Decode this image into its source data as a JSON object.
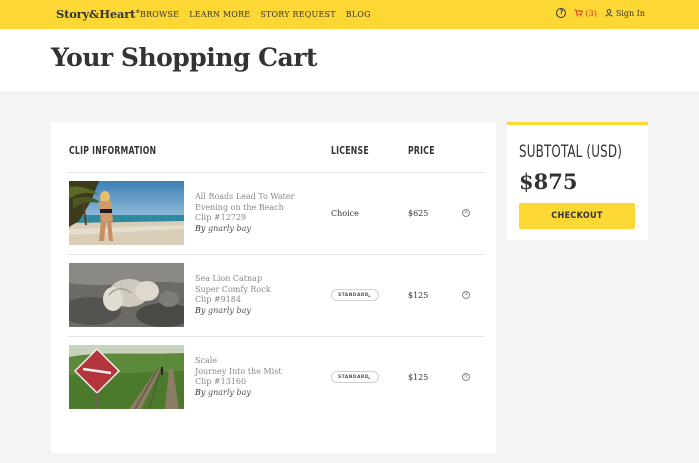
{
  "nav": {
    "logo": "Story&Heart",
    "logo_tm": "®",
    "links": [
      "BROWSE",
      "LEARN MORE",
      "STORY REQUEST",
      "BLOG"
    ],
    "help_icon": "?",
    "cart_count": "(3)",
    "signin": "Sign In"
  },
  "header": {
    "title": "Your Shopping Cart"
  },
  "table": {
    "col_clip": "CLIP INFORMATION",
    "col_license": "LICENSE",
    "col_price": "PRICE"
  },
  "items": [
    {
      "title": "All Roads Lead To Water",
      "subtitle": "Evening on the Beach",
      "clip": "Clip #12729",
      "by": "By",
      "author": "gnarly bay",
      "license": "Choice",
      "price": "$625"
    },
    {
      "title": "Sea Lion Catnap",
      "subtitle": "Super Comfy Rock",
      "clip": "Clip #9184",
      "by": "By",
      "author": "gnarly bay",
      "license": "STANDARD",
      "price": "$125"
    },
    {
      "title": "Scale",
      "subtitle": "Journey Into the Mist",
      "clip": "Clip #13160",
      "by": "By",
      "author": "gnarly bay",
      "license": "STANDARD",
      "price": "$125"
    }
  ],
  "summary": {
    "label": "SUBTOTAL (USD)",
    "amount": "$875",
    "checkout": "CHECKOUT"
  },
  "colors": {
    "accent": "#fdd835",
    "cart_red": "#d9302a"
  }
}
